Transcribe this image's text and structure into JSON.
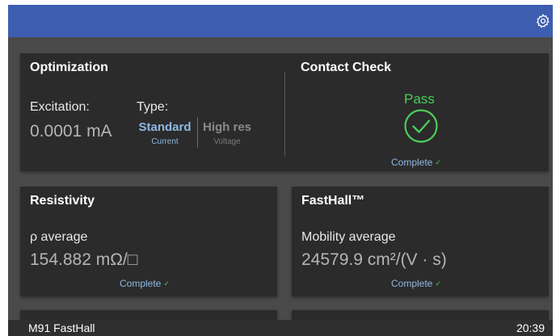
{
  "header": {
    "settings_icon": "gear-icon"
  },
  "optimization": {
    "title": "Optimization",
    "excitation_label": "Excitation:",
    "excitation_value": "0.0001 mA",
    "type_label": "Type:",
    "options": [
      {
        "label": "Standard",
        "sub": "Current",
        "selected": true
      },
      {
        "label": "High res",
        "sub": "Voltage",
        "selected": false
      }
    ]
  },
  "contact_check": {
    "title": "Contact Check",
    "result": "Pass",
    "status": "Complete"
  },
  "resistivity": {
    "title": "Resistivity",
    "label": "ρ average",
    "value": "154.882 mΩ/□",
    "status": "Complete"
  },
  "fasthall": {
    "title": "FastHall™",
    "label": "Mobility average",
    "value": "24579.9 cm²/(V · s)",
    "status": "Complete"
  },
  "status_bar": {
    "app_name": "M91 FastHall",
    "time": "20:39"
  },
  "colors": {
    "topbar": "#3d5db0",
    "background": "#4a4a4a",
    "card": "#2b2b2b",
    "accent": "#8fb8e3",
    "pass": "#4ccc5a"
  }
}
